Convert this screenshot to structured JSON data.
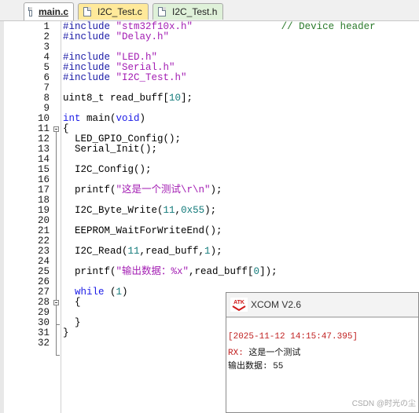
{
  "tabs": [
    {
      "label": "main.c",
      "active": true
    },
    {
      "label": "I2C_Test.c",
      "active": false
    },
    {
      "label": "I2C_Test.h",
      "active": false
    }
  ],
  "line_numbers": [
    "1",
    "2",
    "3",
    "4",
    "5",
    "6",
    "7",
    "8",
    "9",
    "10",
    "11",
    "12",
    "13",
    "14",
    "15",
    "16",
    "17",
    "18",
    "19",
    "20",
    "21",
    "22",
    "23",
    "24",
    "25",
    "26",
    "27",
    "28",
    "29",
    "30",
    "31",
    "32"
  ],
  "code": {
    "l1_a": "#include ",
    "l1_b": "\"stm32f10x.h\"",
    "l1_c": "               ",
    "l1_d": "// Device header",
    "l2_a": "#include ",
    "l2_b": "\"Delay.h\"",
    "l4_a": "#include ",
    "l4_b": "\"LED.h\"",
    "l5_a": "#include ",
    "l5_b": "\"Serial.h\"",
    "l6_a": "#include ",
    "l6_b": "\"I2C_Test.h\"",
    "l8_a": "uint8_t read_buff[",
    "l8_b": "10",
    "l8_c": "];",
    "l10_a": "int",
    "l10_b": " main(",
    "l10_c": "void",
    "l10_d": ")",
    "l11": "{",
    "l12": "  LED_GPIO_Config();",
    "l13": "  Serial_Init();",
    "l15": "  I2C_Config();",
    "l17_a": "  printf(",
    "l17_b": "\"这是一个测试\\r\\n\"",
    "l17_c": ");",
    "l19_a": "  I2C_Byte_Write(",
    "l19_b": "11",
    "l19_c": ",",
    "l19_d": "0x55",
    "l19_e": ");",
    "l21": "  EEPROM_WaitForWriteEnd();",
    "l23_a": "  I2C_Read(",
    "l23_b": "11",
    "l23_c": ",read_buff,",
    "l23_d": "1",
    "l23_e": ");",
    "l25_a": "  printf(",
    "l25_b": "\"输出数据：%x\"",
    "l25_c": ",read_buff[",
    "l25_d": "0",
    "l25_e": "]);",
    "l27_a": "  while",
    "l27_b": " (",
    "l27_c": "1",
    "l27_d": ")",
    "l28": "  {",
    "l30": "  }",
    "l31": "}"
  },
  "xcom": {
    "logo_text": "ATK",
    "title": "XCOM V2.6",
    "timestamp": "[2025-11-12 14:15:47.395]",
    "rx_label": "RX:",
    "rx_text": " 这是一个测试",
    "output_line": "输出数据: 55"
  },
  "watermark": "CSDN @时光の尘",
  "colors": {
    "preprocessor": "#1a1aa6",
    "string": "#a31db3",
    "comment": "#2b7a2b",
    "keyword": "#1a1ae6",
    "number": "#127a7a",
    "tab_yellow": "#ffe99a",
    "tab_green": "#dff1d9"
  }
}
